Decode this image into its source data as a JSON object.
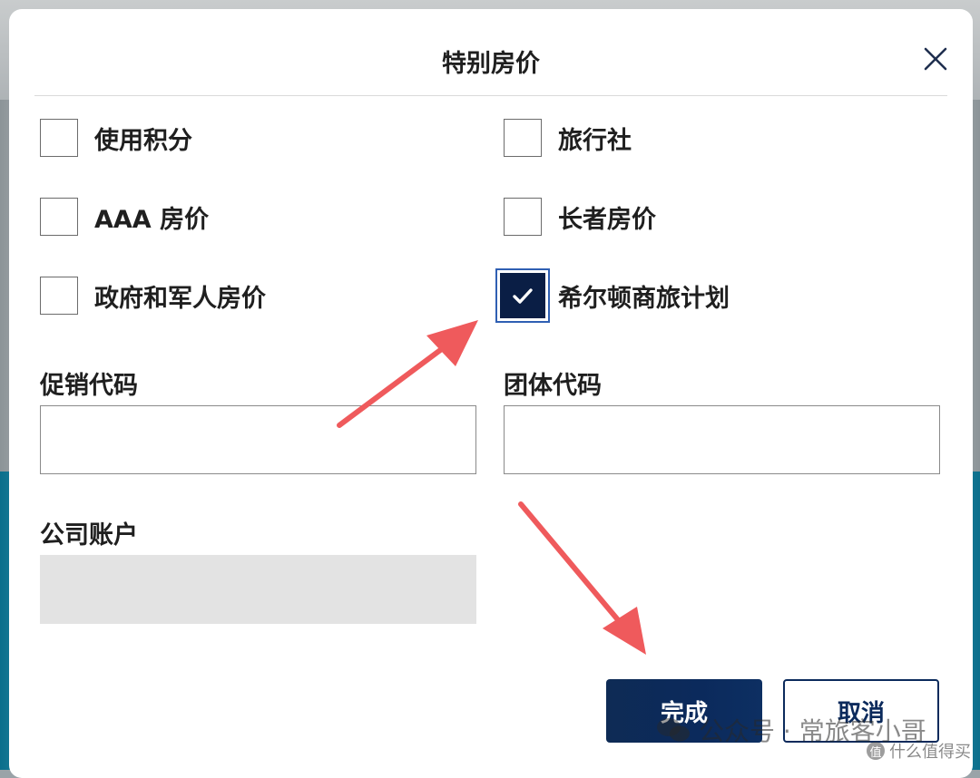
{
  "dialog": {
    "title": "特别房价",
    "close_icon": "close-icon"
  },
  "checkboxes": [
    {
      "label": "使用积分",
      "checked": false
    },
    {
      "label": "旅行社",
      "checked": false
    },
    {
      "label": "AAA 房价",
      "checked": false
    },
    {
      "label": "长者房价",
      "checked": false
    },
    {
      "label": "政府和军人房价",
      "checked": false
    },
    {
      "label": "希尔顿商旅计划",
      "checked": true
    }
  ],
  "fields": {
    "promo_code": {
      "label": "促销代码",
      "value": ""
    },
    "group_code": {
      "label": "团体代码",
      "value": ""
    },
    "corporate_account": {
      "label": "公司账户",
      "value": "",
      "disabled": true
    }
  },
  "buttons": {
    "done": "完成",
    "cancel": "取消"
  },
  "annotations": {
    "arrow_color": "#ef5a5c"
  },
  "colors": {
    "primary": "#0b2a5c",
    "checked_focus": "#2f5fb3",
    "disabled_field": "#e3e3e3"
  },
  "watermark": {
    "text": "公众号 · 常旅客小哥",
    "sub_badge": "值",
    "sub_text": "什么值得买"
  }
}
